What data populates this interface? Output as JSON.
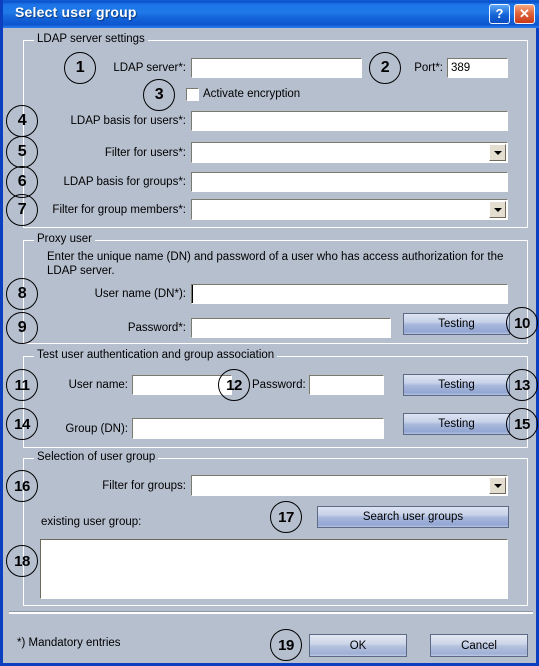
{
  "window": {
    "title": "Select user group",
    "help_button": "?",
    "close_button": "✕"
  },
  "groups": {
    "ldap": {
      "title": "LDAP server settings",
      "fields": {
        "server_label": "LDAP server*:",
        "server_value": "",
        "port_label": "Port*:",
        "port_value": "389",
        "encryption_label": "Activate encryption",
        "basis_users_label": "LDAP basis for users*:",
        "basis_users_value": "",
        "filter_users_label": "Filter for users*:",
        "filter_users_value": "",
        "basis_groups_label": "LDAP basis for groups*:",
        "basis_groups_value": "",
        "filter_members_label": "Filter for group members*:",
        "filter_members_value": ""
      }
    },
    "proxy": {
      "title": "Proxy user",
      "description": "Enter the unique name (DN) and password of a user who has access authorization for the LDAP server.",
      "username_label": "User name (DN*):",
      "username_value": "",
      "password_label": "Password*:",
      "password_value": "",
      "test_button": "Testing"
    },
    "test": {
      "title": "Test user authentication and group association",
      "username_label": "User name:",
      "username_value": "",
      "password_label": "Password:",
      "password_value": "",
      "test_button_1": "Testing",
      "group_label": "Group (DN):",
      "group_value": "",
      "test_button_2": "Testing"
    },
    "selection": {
      "title": "Selection of user group",
      "filter_label": "Filter for groups:",
      "filter_value": "",
      "search_button": "Search user groups",
      "existing_label": "existing user group:",
      "list_items": []
    }
  },
  "footer": {
    "mandatory_note": "*) Mandatory entries",
    "ok_button": "OK",
    "cancel_button": "Cancel"
  },
  "callouts": {
    "n1": "1",
    "n2": "2",
    "n3": "3",
    "n4": "4",
    "n5": "5",
    "n6": "6",
    "n7": "7",
    "n8": "8",
    "n9": "9",
    "n10": "10",
    "n11": "11",
    "n12": "12",
    "n13": "13",
    "n14": "14",
    "n15": "15",
    "n16": "16",
    "n17": "17",
    "n18": "18",
    "n19": "19"
  },
  "colors": {
    "dialog_background": "#b6bfce",
    "title_bar": "#1668dc",
    "window_border": "#0b3fbf",
    "field_background": "#ffffff",
    "button_face": "#b4c1dd"
  }
}
